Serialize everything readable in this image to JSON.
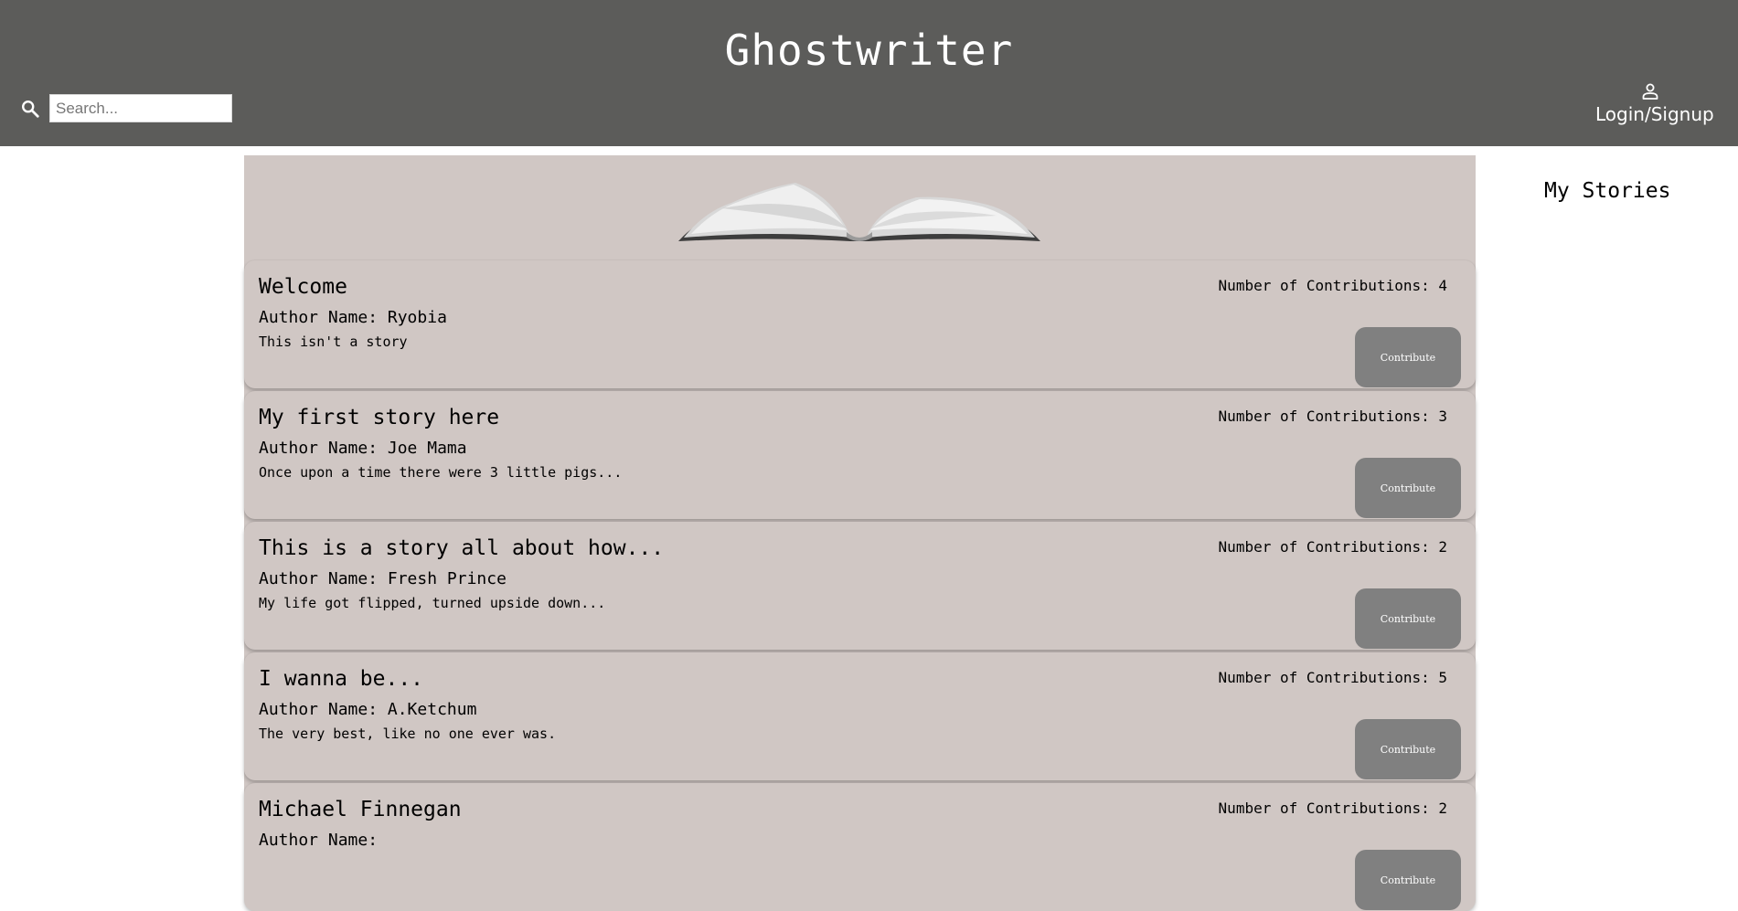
{
  "header": {
    "title": "Ghostwriter",
    "search_placeholder": "Search...",
    "search_value": "",
    "login_label": "Login/Signup"
  },
  "sidebar": {
    "title": "My Stories"
  },
  "stories": [
    {
      "title": "Welcome",
      "author": "Author Name: Ryobia",
      "excerpt": "This isn't a story",
      "contributions": "Number of Contributions: 4",
      "button": "Contribute"
    },
    {
      "title": "My first story here",
      "author": "Author Name: Joe Mama",
      "excerpt": "Once upon a time there were 3 little pigs...",
      "contributions": "Number of Contributions: 3",
      "button": "Contribute"
    },
    {
      "title": "This is a story all about how...",
      "author": "Author Name: Fresh Prince",
      "excerpt": "My life got flipped, turned upside down...",
      "contributions": "Number of Contributions: 2",
      "button": "Contribute"
    },
    {
      "title": "I wanna be...",
      "author": "Author Name: A.Ketchum",
      "excerpt": "The very best, like no one ever was.",
      "contributions": "Number of Contributions: 5",
      "button": "Contribute"
    },
    {
      "title": "Michael Finnegan",
      "author": "Author Name:",
      "excerpt": "",
      "contributions": "Number of Contributions: 2",
      "button": "Contribute"
    }
  ],
  "icons": {
    "search": "search-icon",
    "user": "person-icon",
    "book": "open-book-icon"
  },
  "colors": {
    "header": "#5c5c5a",
    "card": "#d0c7c4",
    "button": "#808080"
  }
}
